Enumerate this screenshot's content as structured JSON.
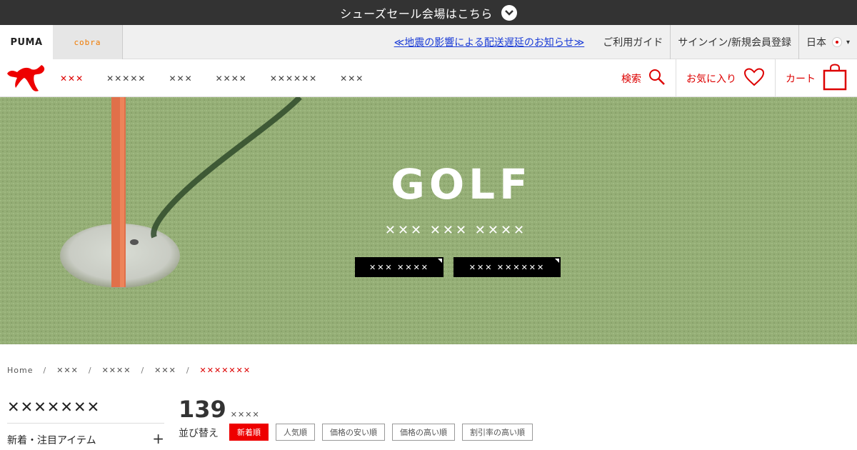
{
  "promo": {
    "text": "シューズセール会場はこちら",
    "icon": "chevron-down-icon"
  },
  "brands": {
    "puma": "PUMA",
    "cobra": "cobra"
  },
  "utility": {
    "notice": "≪地震の影響による配送遅延のお知らせ≫",
    "guide": "ご利用ガイド",
    "signin": "サインイン/新規会員登録",
    "country": "日本"
  },
  "nav": {
    "items": [
      {
        "label": "✕✕✕",
        "active": true
      },
      {
        "label": "✕✕✕✕✕",
        "active": false
      },
      {
        "label": "✕✕✕",
        "active": false
      },
      {
        "label": "✕✕✕✕",
        "active": false
      },
      {
        "label": "✕✕✕✕✕✕",
        "active": false
      },
      {
        "label": "✕✕✕",
        "active": false
      }
    ],
    "search_label": "検索",
    "favorites_label": "お気に入り",
    "cart_label": "カート"
  },
  "hero": {
    "title": "GOLF",
    "subtitle": "✕✕✕ ✕✕✕ ✕✕✕✕",
    "button1": "✕✕✕ ✕✕✕✕",
    "button2": "✕✕✕ ✕✕✕✕✕✕"
  },
  "breadcrumb": {
    "items": [
      "Home",
      "✕✕✕",
      "✕✕✕✕",
      "✕✕✕",
      "✕✕✕✕✕✕✕"
    ],
    "separator": "/"
  },
  "sidebar": {
    "title": "✕✕✕✕✕✕✕",
    "filter1": "新着・注目アイテム"
  },
  "results": {
    "count": "139",
    "count_unit": "✕✕✕✕",
    "sort_label": "並び替え",
    "sort_options": [
      "新着順",
      "人気順",
      "価格の安い順",
      "価格の高い順",
      "割引率の高い順"
    ]
  },
  "colors": {
    "accent": "#dd0000",
    "dark": "#333333",
    "link": "#1a3bd6"
  }
}
